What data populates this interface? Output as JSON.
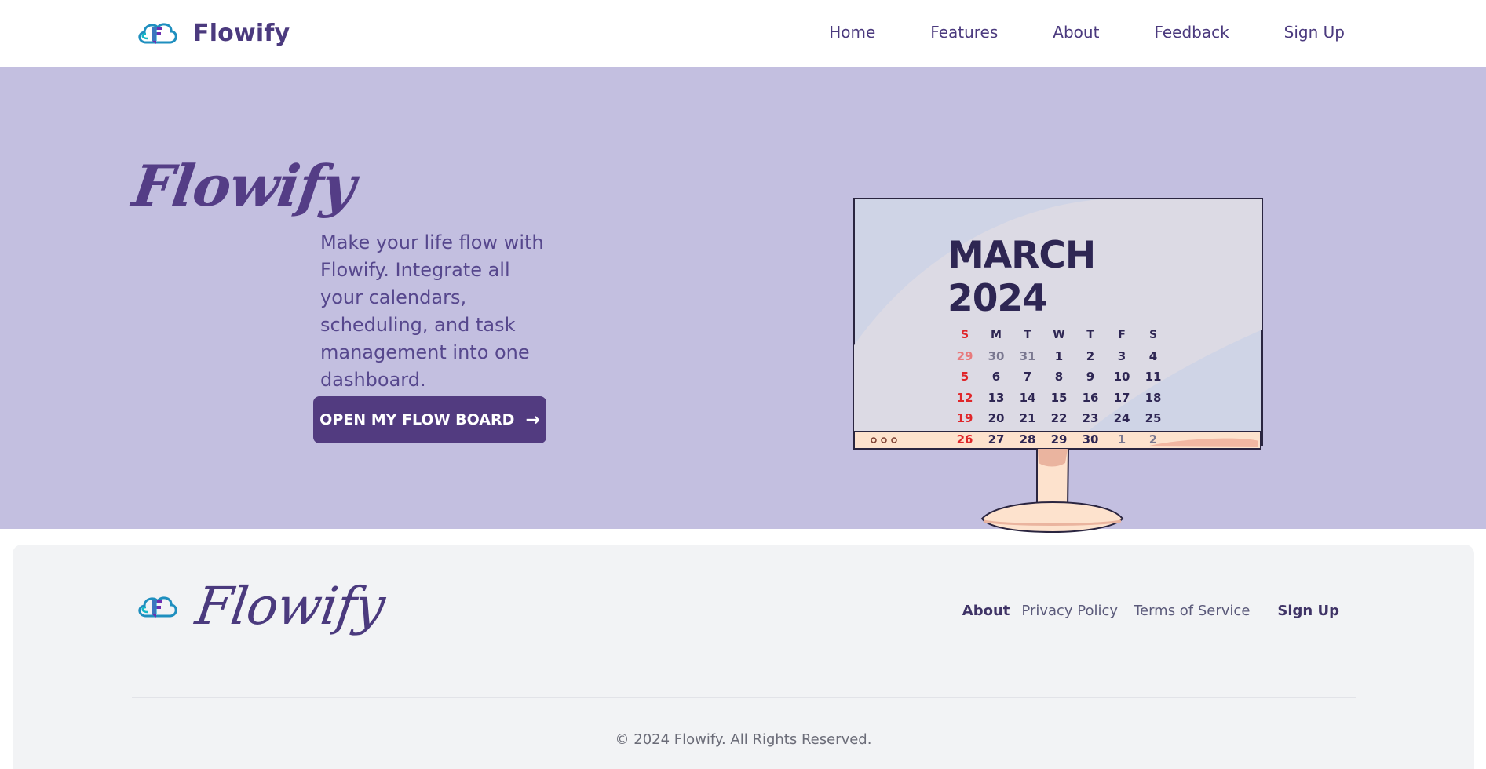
{
  "brand": {
    "name": "Flowify"
  },
  "nav": {
    "items": [
      {
        "label": "Home"
      },
      {
        "label": "Features"
      },
      {
        "label": "About"
      },
      {
        "label": "Feedback"
      },
      {
        "label": "Sign Up"
      }
    ]
  },
  "hero": {
    "title": "Flowify",
    "description": "Make your life flow with Flowify. Integrate all your calendars, scheduling, and task management into one dashboard.",
    "cta_label": "OPEN MY FLOW BOARD",
    "cta_icon": "arrow-right-icon"
  },
  "calendar": {
    "title": "MARCH 2024",
    "weekdays": [
      "S",
      "M",
      "T",
      "W",
      "T",
      "F",
      "S"
    ],
    "weeks": [
      [
        "29",
        "30",
        "31",
        "1",
        "2",
        "3",
        "4"
      ],
      [
        "5",
        "6",
        "7",
        "8",
        "9",
        "10",
        "11"
      ],
      [
        "12",
        "13",
        "14",
        "15",
        "16",
        "17",
        "18"
      ],
      [
        "19",
        "20",
        "21",
        "22",
        "23",
        "24",
        "25"
      ],
      [
        "26",
        "27",
        "28",
        "29",
        "30",
        "1",
        "2"
      ]
    ],
    "colors": {
      "sunday": "#e0262a",
      "default": "#2e2653",
      "muted": "#7a7890"
    }
  },
  "footer": {
    "brand_name": "Flowify",
    "links": {
      "about": "About",
      "privacy": "Privacy Policy",
      "terms": "Terms of Service",
      "signup": "Sign Up"
    },
    "copyright": "© 2024 Flowify. All Rights Reserved."
  },
  "colors": {
    "primary": "#523b80",
    "hero_bg": "#c3bfe0",
    "footer_bg": "#f2f3f5"
  }
}
